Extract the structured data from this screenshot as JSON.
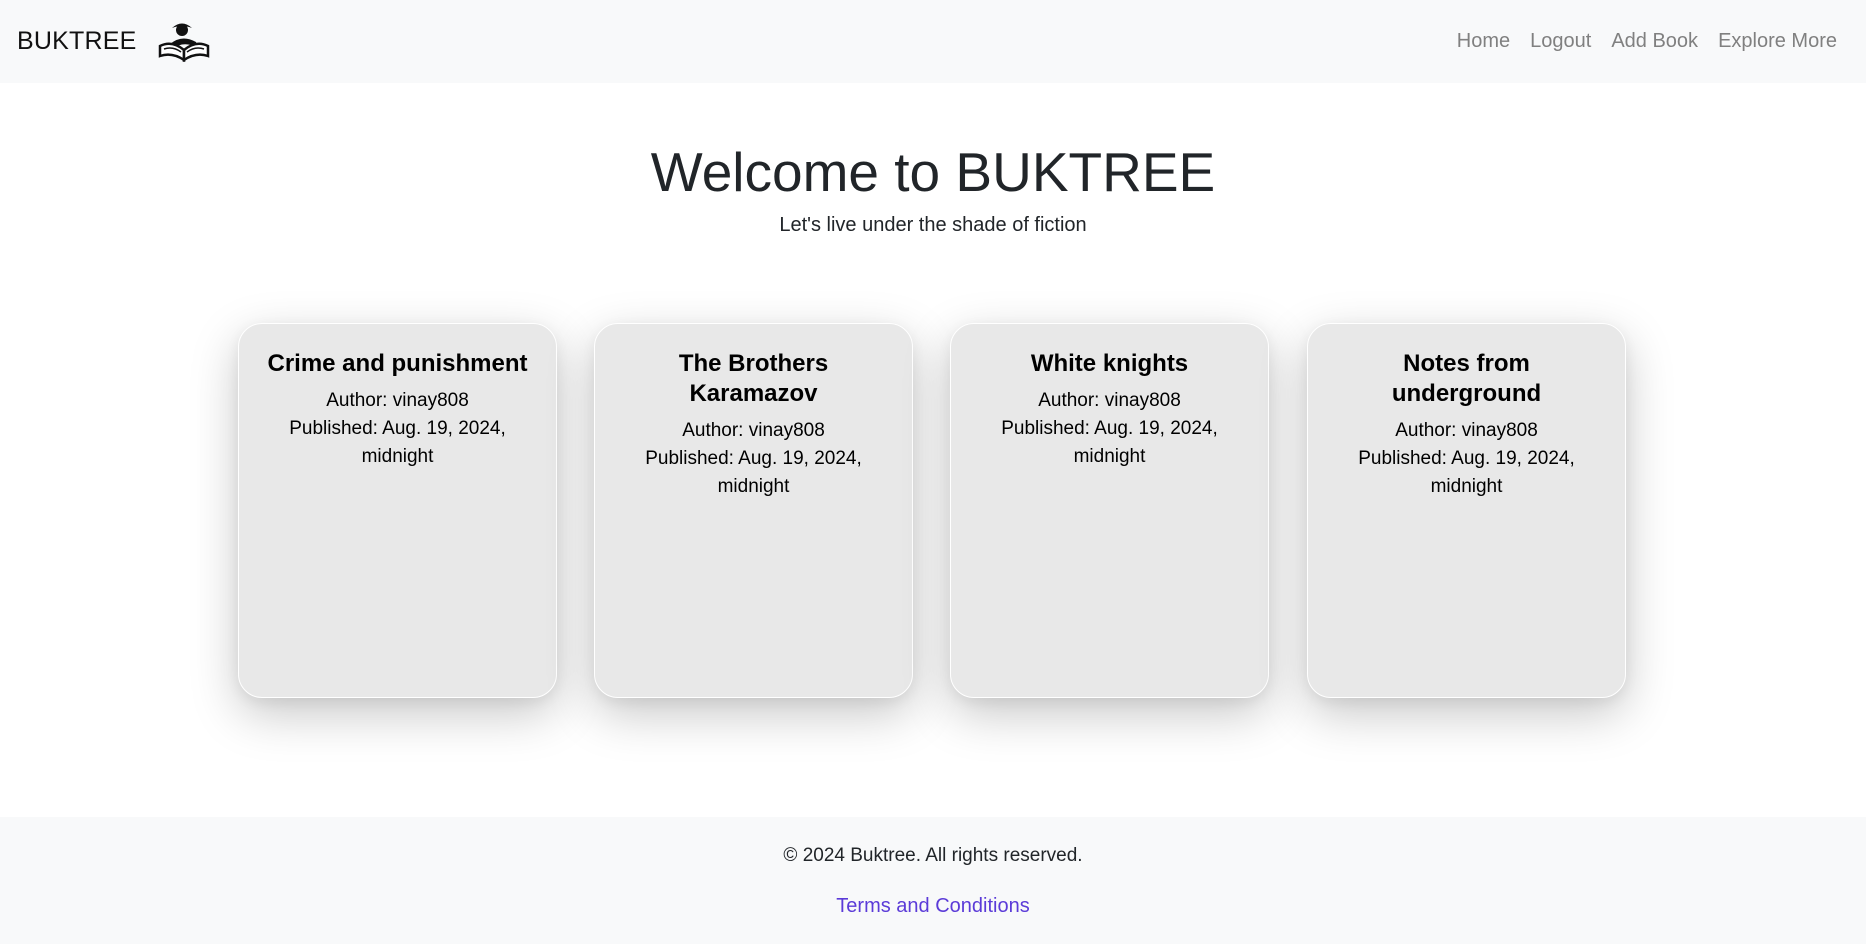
{
  "navbar": {
    "brand": "BUKTREE",
    "logo_icon": "open-book-reader-icon",
    "links": [
      {
        "label": "Home"
      },
      {
        "label": "Logout"
      },
      {
        "label": "Add Book"
      },
      {
        "label": "Explore More"
      }
    ]
  },
  "hero": {
    "title": "Welcome to BUKTREE",
    "subtitle": "Let's live under the shade of fiction"
  },
  "books": [
    {
      "title": "Crime and punishment",
      "author": "Author: vinay808",
      "published": "Published: Aug. 19, 2024, midnight"
    },
    {
      "title": "The Brothers Karamazov",
      "author": "Author: vinay808",
      "published": "Published: Aug. 19, 2024, midnight"
    },
    {
      "title": "White knights",
      "author": "Author: vinay808",
      "published": "Published: Aug. 19, 2024, midnight"
    },
    {
      "title": "Notes from underground",
      "author": "Author: vinay808",
      "published": "Published: Aug. 19, 2024, midnight"
    }
  ],
  "footer": {
    "copyright": "© 2024 Buktree. All rights reserved.",
    "terms": "Terms and Conditions"
  },
  "colors": {
    "navbar_bg": "#f8f9fa",
    "card_bg": "#e8e8e8",
    "link_muted": "#808080",
    "terms_link": "#5b3bd8"
  }
}
